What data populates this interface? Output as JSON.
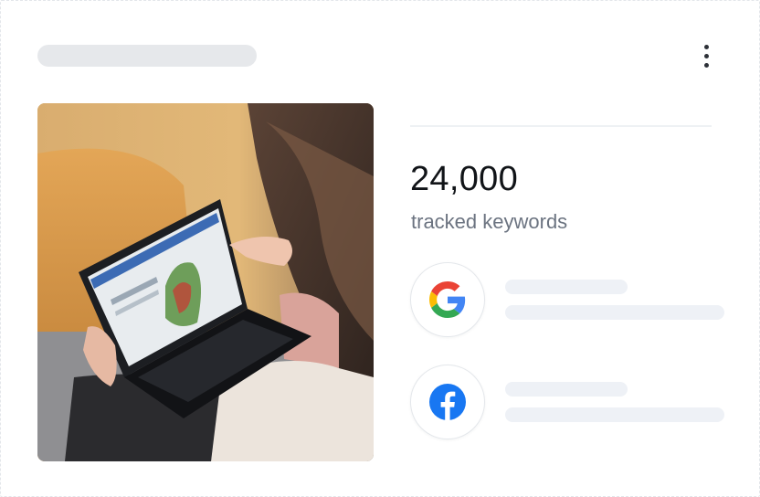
{
  "header": {
    "title_placeholder": "",
    "menu_icon": "more-vertical-icon"
  },
  "metric": {
    "value": "24,000",
    "label": "tracked keywords"
  },
  "sources": [
    {
      "icon": "google-logo-icon"
    },
    {
      "icon": "facebook-logo-icon"
    }
  ],
  "photo": {
    "subject": "person-using-laptop-image"
  },
  "colors": {
    "skeleton": "#eef1f6",
    "title_skeleton": "#e6e8eb",
    "value_text": "#111418",
    "label_text": "#6b7380",
    "facebook_blue": "#1877f2",
    "google_blue": "#4285f4",
    "google_red": "#ea4335",
    "google_yellow": "#fbbc05",
    "google_green": "#34a853"
  }
}
